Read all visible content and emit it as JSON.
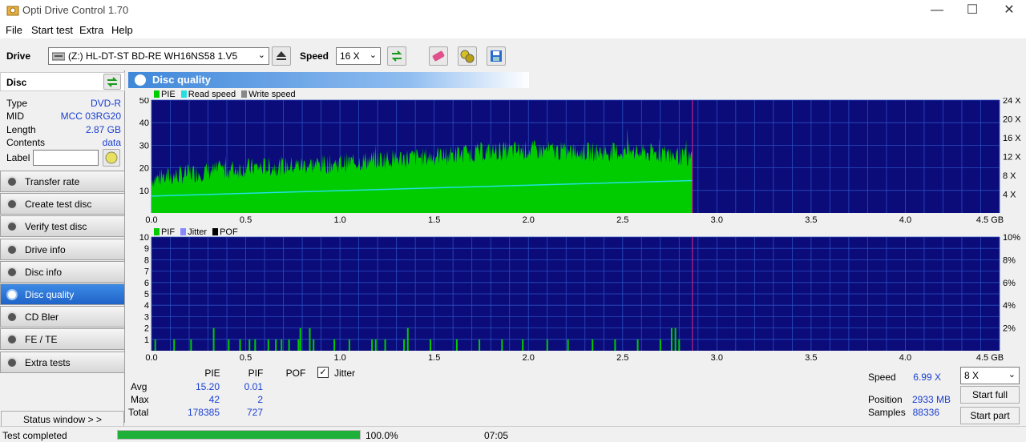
{
  "window": {
    "title": "Opti Drive Control 1.70",
    "min": "—",
    "max": "☐",
    "close": "✕"
  },
  "menu": [
    "File",
    "Start test",
    "Extra",
    "Help"
  ],
  "toolbar": {
    "drive_label": "Drive",
    "drive_value": "(Z:)  HL-DT-ST BD-RE  WH16NS58 1.V5",
    "speed_label": "Speed",
    "speed_value": "16 X"
  },
  "disc": {
    "header": "Disc",
    "rows": [
      {
        "key": "Type",
        "value": "DVD-R"
      },
      {
        "key": "MID",
        "value": "MCC 03RG20"
      },
      {
        "key": "Length",
        "value": "2.87 GB"
      },
      {
        "key": "Contents",
        "value": "data"
      }
    ],
    "label_key": "Label",
    "label_value": ""
  },
  "nav": [
    {
      "label": "Transfer rate",
      "active": false
    },
    {
      "label": "Create test disc",
      "active": false
    },
    {
      "label": "Verify test disc",
      "active": false
    },
    {
      "label": "Drive info",
      "active": false
    },
    {
      "label": "Disc info",
      "active": false
    },
    {
      "label": "Disc quality",
      "active": true
    },
    {
      "label": "CD Bler",
      "active": false
    },
    {
      "label": "FE / TE",
      "active": false
    },
    {
      "label": "Extra tests",
      "active": false
    }
  ],
  "status_window_btn": "Status window > >",
  "panel_title": "Disc quality",
  "chart_data": [
    {
      "type": "area",
      "legend": [
        "PIE",
        "Read speed",
        "Write speed"
      ],
      "colors": {
        "PIE": "#00cc00",
        "Read speed": "#22e0e0",
        "Write speed": "#888888",
        "background": "#0b0b7a",
        "grid": "#2a55c8",
        "marker": "#c0208a"
      },
      "x_ticks": [
        "0.0",
        "0.5",
        "1.0",
        "1.5",
        "2.0",
        "2.5",
        "3.0",
        "3.5",
        "4.0",
        "4.5 GB"
      ],
      "xlim": [
        0,
        4.5
      ],
      "y_left_ticks": [
        "10",
        "20",
        "30",
        "40",
        "50"
      ],
      "ylim_left": [
        0,
        50
      ],
      "y_right_ticks": [
        "4 X",
        "8 X",
        "12 X",
        "16 X",
        "20 X",
        "24 X"
      ],
      "ylim_right": [
        0,
        24
      ],
      "disc_end": 2.87,
      "pie_profile": {
        "x": [
          0,
          0.25,
          0.5,
          0.75,
          1.0,
          1.25,
          1.5,
          1.75,
          2.0,
          2.25,
          2.5,
          2.75,
          2.87
        ],
        "y": [
          15,
          18,
          20,
          21,
          22,
          24,
          25,
          27,
          28,
          27,
          27,
          26,
          24
        ]
      },
      "read_speed": {
        "x": [
          0,
          2.87
        ],
        "y": [
          3.6,
          6.9
        ]
      }
    },
    {
      "type": "bar",
      "legend": [
        "PIF",
        "Jitter",
        "POF"
      ],
      "colors": {
        "PIF": "#00cc00",
        "Jitter": "#8888ff",
        "POF": "#000000"
      },
      "x_ticks": [
        "0.0",
        "0.5",
        "1.0",
        "1.5",
        "2.0",
        "2.5",
        "3.0",
        "3.5",
        "4.0",
        "4.5 GB"
      ],
      "xlim": [
        0,
        4.5
      ],
      "y_left_ticks": [
        "1",
        "2",
        "3",
        "4",
        "5",
        "6",
        "7",
        "8",
        "9",
        "10"
      ],
      "ylim_left": [
        0,
        10
      ],
      "y_right_ticks": [
        "2%",
        "4%",
        "6%",
        "8%",
        "10%"
      ],
      "disc_end": 2.87,
      "pif_points": [
        {
          "x": 0.02,
          "y": 1
        },
        {
          "x": 0.12,
          "y": 1
        },
        {
          "x": 0.21,
          "y": 1
        },
        {
          "x": 0.33,
          "y": 2
        },
        {
          "x": 0.41,
          "y": 1
        },
        {
          "x": 0.47,
          "y": 1
        },
        {
          "x": 0.52,
          "y": 1
        },
        {
          "x": 0.55,
          "y": 1
        },
        {
          "x": 0.62,
          "y": 1
        },
        {
          "x": 0.66,
          "y": 1
        },
        {
          "x": 0.69,
          "y": 1
        },
        {
          "x": 0.73,
          "y": 1
        },
        {
          "x": 0.78,
          "y": 1
        },
        {
          "x": 0.79,
          "y": 2
        },
        {
          "x": 0.84,
          "y": 2
        },
        {
          "x": 0.86,
          "y": 1
        },
        {
          "x": 0.97,
          "y": 1
        },
        {
          "x": 1.05,
          "y": 1
        },
        {
          "x": 1.17,
          "y": 1
        },
        {
          "x": 1.19,
          "y": 1
        },
        {
          "x": 1.24,
          "y": 1
        },
        {
          "x": 1.34,
          "y": 1
        },
        {
          "x": 1.36,
          "y": 2
        },
        {
          "x": 1.48,
          "y": 1
        },
        {
          "x": 1.62,
          "y": 1
        },
        {
          "x": 1.74,
          "y": 1
        },
        {
          "x": 1.86,
          "y": 1
        },
        {
          "x": 1.97,
          "y": 1
        },
        {
          "x": 2.1,
          "y": 1
        },
        {
          "x": 2.21,
          "y": 1
        },
        {
          "x": 2.34,
          "y": 1
        },
        {
          "x": 2.46,
          "y": 1
        },
        {
          "x": 2.58,
          "y": 1
        },
        {
          "x": 2.7,
          "y": 1
        },
        {
          "x": 2.76,
          "y": 2
        },
        {
          "x": 2.78,
          "y": 2
        },
        {
          "x": 2.8,
          "y": 1
        }
      ]
    }
  ],
  "stats": {
    "headers": [
      "PIE",
      "PIF",
      "POF"
    ],
    "jitter_label": "Jitter",
    "jitter_checked": true,
    "rows": [
      {
        "label": "Avg",
        "pie": "15.20",
        "pif": "0.01"
      },
      {
        "label": "Max",
        "pie": "42",
        "pif": "2"
      },
      {
        "label": "Total",
        "pie": "178385",
        "pif": "727"
      }
    ],
    "speed_label": "Speed",
    "speed_value": "6.99 X",
    "speed_select": "8 X",
    "position_label": "Position",
    "position_value": "2933 MB",
    "samples_label": "Samples",
    "samples_value": "88336",
    "start_full": "Start full",
    "start_part": "Start part"
  },
  "status": {
    "text": "Test completed",
    "progress": 1.0,
    "progress_text": "100.0%",
    "time": "07:05"
  }
}
